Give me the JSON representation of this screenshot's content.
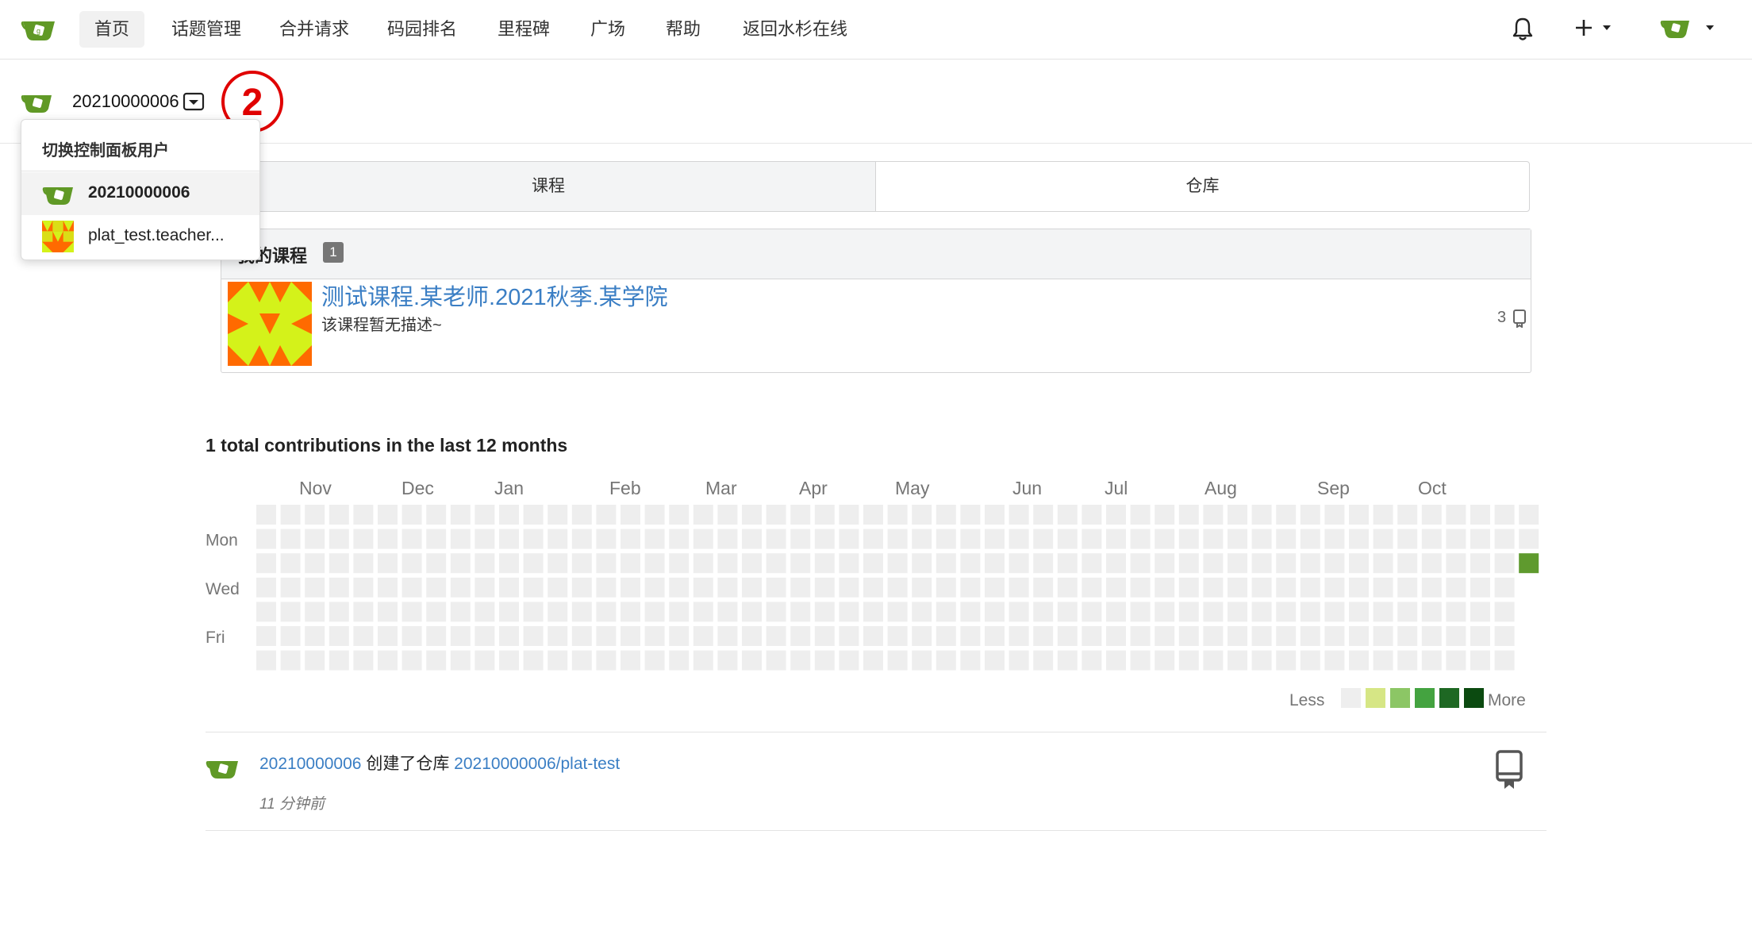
{
  "nav": {
    "items": [
      "首页",
      "话题管理",
      "合并请求",
      "码园排名",
      "里程碑",
      "广场",
      "帮助",
      "返回水杉在线"
    ],
    "active_index": 0,
    "logo_icon": "gitea-teacup-icon",
    "bell_icon": "bell-icon",
    "plus_icon": "plus-icon",
    "avatar_icon": "gitea-teacup-icon"
  },
  "context": {
    "username": "20210000006",
    "annotation": "②"
  },
  "dropdown": {
    "header": "切换控制面板用户",
    "items": [
      {
        "label": "20210000006",
        "selected": true
      },
      {
        "label": "plat_test.teacher...",
        "selected": false
      }
    ]
  },
  "tabs": [
    "课程",
    "仓库"
  ],
  "courses": {
    "header": "我的课程",
    "count": "1",
    "items": [
      {
        "title": "测试课程.某老师.2021秋季.某学院",
        "description": "该课程暂无描述~",
        "repo_count": "3"
      }
    ]
  },
  "contrib": {
    "title": "1 total contributions in the last 12 months",
    "months": [
      "Nov",
      "Dec",
      "Jan",
      "Feb",
      "Mar",
      "Apr",
      "May",
      "Jun",
      "Jul",
      "Aug",
      "Sep",
      "Oct"
    ],
    "days": [
      "Mon",
      "Wed",
      "Fri"
    ],
    "legend_less": "Less",
    "legend_more": "More",
    "colors": [
      "#eeeeee",
      "#d6e685",
      "#8cc665",
      "#44a340",
      "#1e6823",
      "#0b4a10"
    ],
    "active_cell_color": "#5f9a2e"
  },
  "feed": [
    {
      "user": "20210000006",
      "action": "创建了仓库",
      "repo": "20210000006/plat-test",
      "time": "11 分钟前"
    }
  ],
  "colors": {
    "link": "#3a7ec4",
    "brand_green": "#609926",
    "annotation_red": "#e00000"
  }
}
